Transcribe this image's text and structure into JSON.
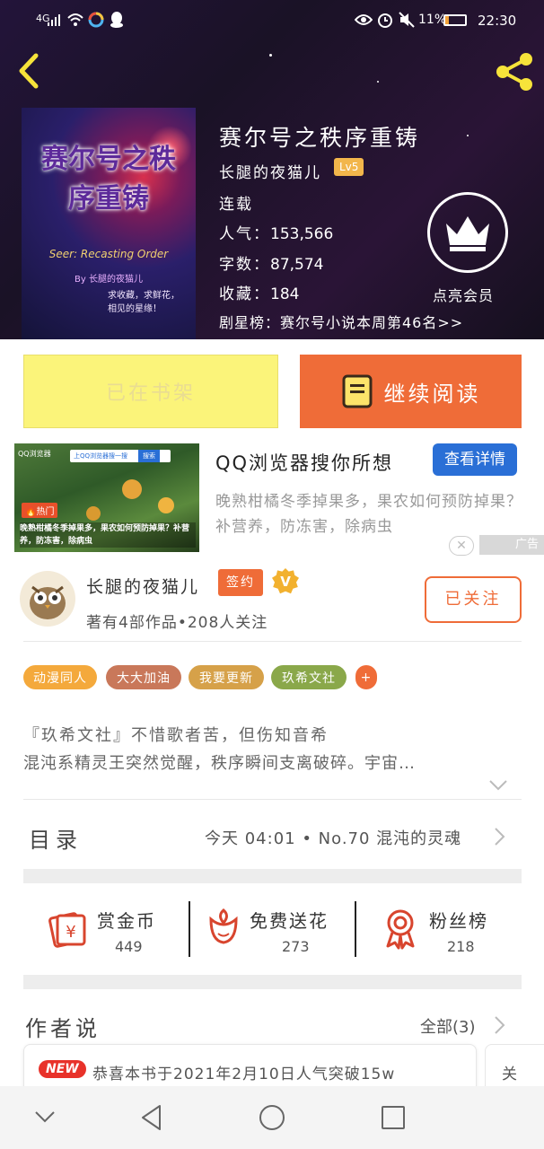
{
  "status_bar": {
    "network": "4G",
    "battery": "11%",
    "time": "22:30"
  },
  "book": {
    "title": "赛尔号之秩序重铸",
    "author": "长腿的夜猫儿",
    "level": "Lv5",
    "status": "连载",
    "popularity_label": "人气：",
    "popularity": "153,566",
    "word_count_label": "字数：",
    "word_count": "87,574",
    "favorites_label": "收藏：",
    "favorites": "184",
    "rank": "剧星榜：赛尔号小说本周第46名>>",
    "cover_title": "赛尔号之秩序重铸",
    "cover_subtitle": "Seer: Recasting Order",
    "cover_author": "By 长腿的夜猫儿",
    "cover_slogan": "求收藏，求鲜花，\n相见的星缘！"
  },
  "vip": {
    "label": "点亮会员"
  },
  "actions": {
    "shelf_label": "已在书架",
    "read_label": "继续阅读"
  },
  "ad": {
    "title": "QQ浏览器搜你所想",
    "details_button": "查看详情",
    "description": "晚熟柑橘冬季掉果多，果农如何预防掉果？补营养，防冻害，除病虫",
    "badge": "广告",
    "img_search_text": "上QQ浏览器搜一搜",
    "img_search_button": "搜索",
    "img_hot": "热门",
    "img_caption": "晚熟柑橘冬季掉果多，果农如何预防掉果？补营养，防冻害，除病虫",
    "img_logo": "QQ浏览器"
  },
  "author": {
    "name": "长腿的夜猫儿",
    "sign_badge": "签约",
    "v_badge": "V",
    "stats": "著有4部作品•208人关注",
    "follow_label": "已关注"
  },
  "tags": [
    "动漫同人",
    "大大加油",
    "我要更新",
    "玖希文社",
    "+"
  ],
  "tag_colors": [
    "#f4a93c",
    "#c9785a",
    "#d6a149",
    "#8aa84a",
    "#ef6c38"
  ],
  "intro": {
    "line1": "『玖希文社』不惜歌者苦，但伤知音希",
    "line2": "混沌系精灵王突然觉醒，秩序瞬间支离破碎。宇宙…"
  },
  "catalog": {
    "label": "目录",
    "latest": "今天 04:01 • No.70 混沌的灵魂"
  },
  "stats": {
    "reward_label": "赏金币",
    "reward_value": "449",
    "flower_label": "免费送花",
    "flower_value": "273",
    "fans_label": "粉丝榜",
    "fans_value": "218"
  },
  "author_says": {
    "label": "作者说",
    "all_label": "全部(3)",
    "new_badge": "NEW",
    "post_text": "恭喜本书于2021年2月10日人气突破15w",
    "next_card_text": "关"
  },
  "colors": {
    "accent": "#ef6c38",
    "shelf_yellow": "#fbf47a",
    "ad_blue": "#2a6fd6"
  }
}
